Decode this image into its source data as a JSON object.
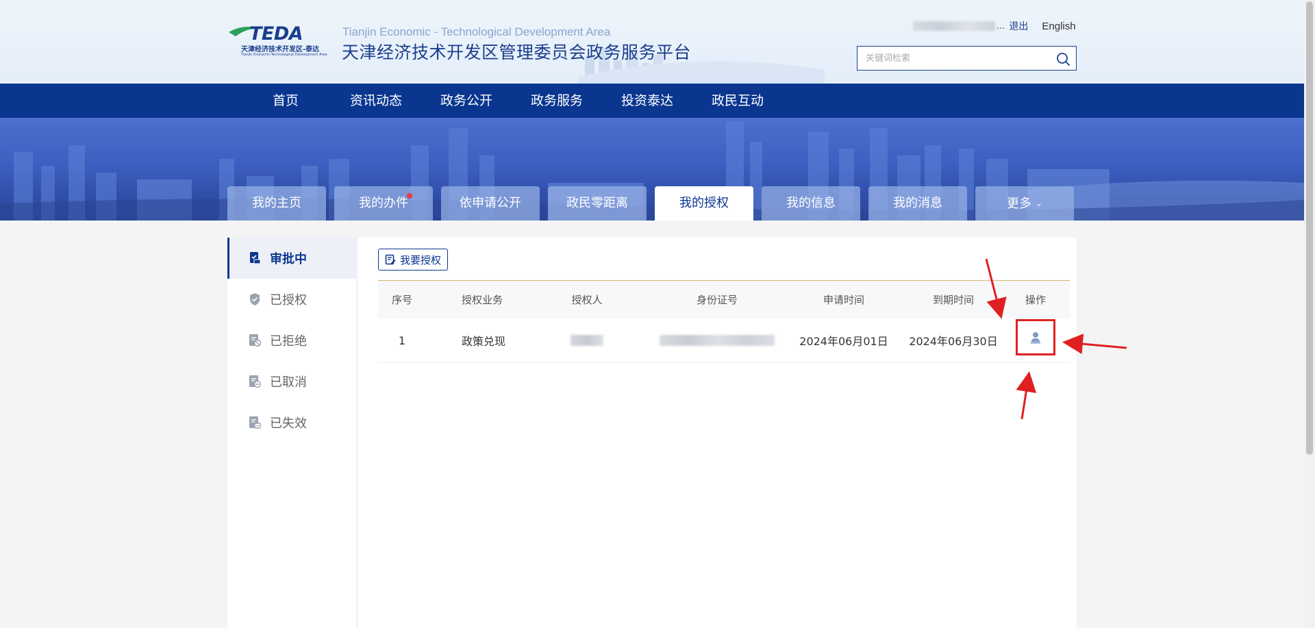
{
  "header": {
    "logo_text": "TEDA",
    "logo_cn": "天津经济技术开发区-泰达",
    "logo_en": "Tianjin Economic-Technological Development Area",
    "site_title_en": "Tianjin Economic - Technological Development Area",
    "site_title_cn": "天津经济技术开发区管理委员会政务服务平台",
    "user_suffix": "...",
    "logout": "退出",
    "language": "English",
    "search_placeholder": "关键词检索"
  },
  "nav": {
    "items": [
      {
        "label": "首页"
      },
      {
        "label": "资讯动态"
      },
      {
        "label": "政务公开"
      },
      {
        "label": "政务服务"
      },
      {
        "label": "投资泰达"
      },
      {
        "label": "政民互动"
      }
    ]
  },
  "tabs": {
    "items": [
      {
        "label": "我的主页"
      },
      {
        "label": "我的办件"
      },
      {
        "label": "依申请公开"
      },
      {
        "label": "政民零距离"
      },
      {
        "label": "我的授权"
      },
      {
        "label": "我的信息"
      },
      {
        "label": "我的消息"
      },
      {
        "label": "更多"
      }
    ],
    "active_index": 4
  },
  "sidebar": {
    "items": [
      {
        "label": "审批中"
      },
      {
        "label": "已授权"
      },
      {
        "label": "已拒绝"
      },
      {
        "label": "已取消"
      },
      {
        "label": "已失效"
      }
    ],
    "active_index": 0
  },
  "main": {
    "auth_button": "我要授权",
    "table": {
      "headers": [
        "序号",
        "授权业务",
        "授权人",
        "身份证号",
        "申请时间",
        "到期时间",
        "操作"
      ],
      "rows": [
        {
          "index": "1",
          "business": "政策兑现",
          "start": "2024年06月01日",
          "end": "2024年06月30日"
        }
      ]
    }
  },
  "colors": {
    "brand_blue": "#0a3690",
    "highlight_red": "#e02020",
    "table_top_line": "#d9b36e"
  },
  "icons": {
    "search": "search-icon",
    "approval": "approval-doc-icon",
    "authorized": "shield-check-icon",
    "rejected": "doc-reject-icon",
    "cancelled": "doc-cancel-icon",
    "expired": "doc-expired-icon",
    "operate": "person-stamp-icon"
  }
}
